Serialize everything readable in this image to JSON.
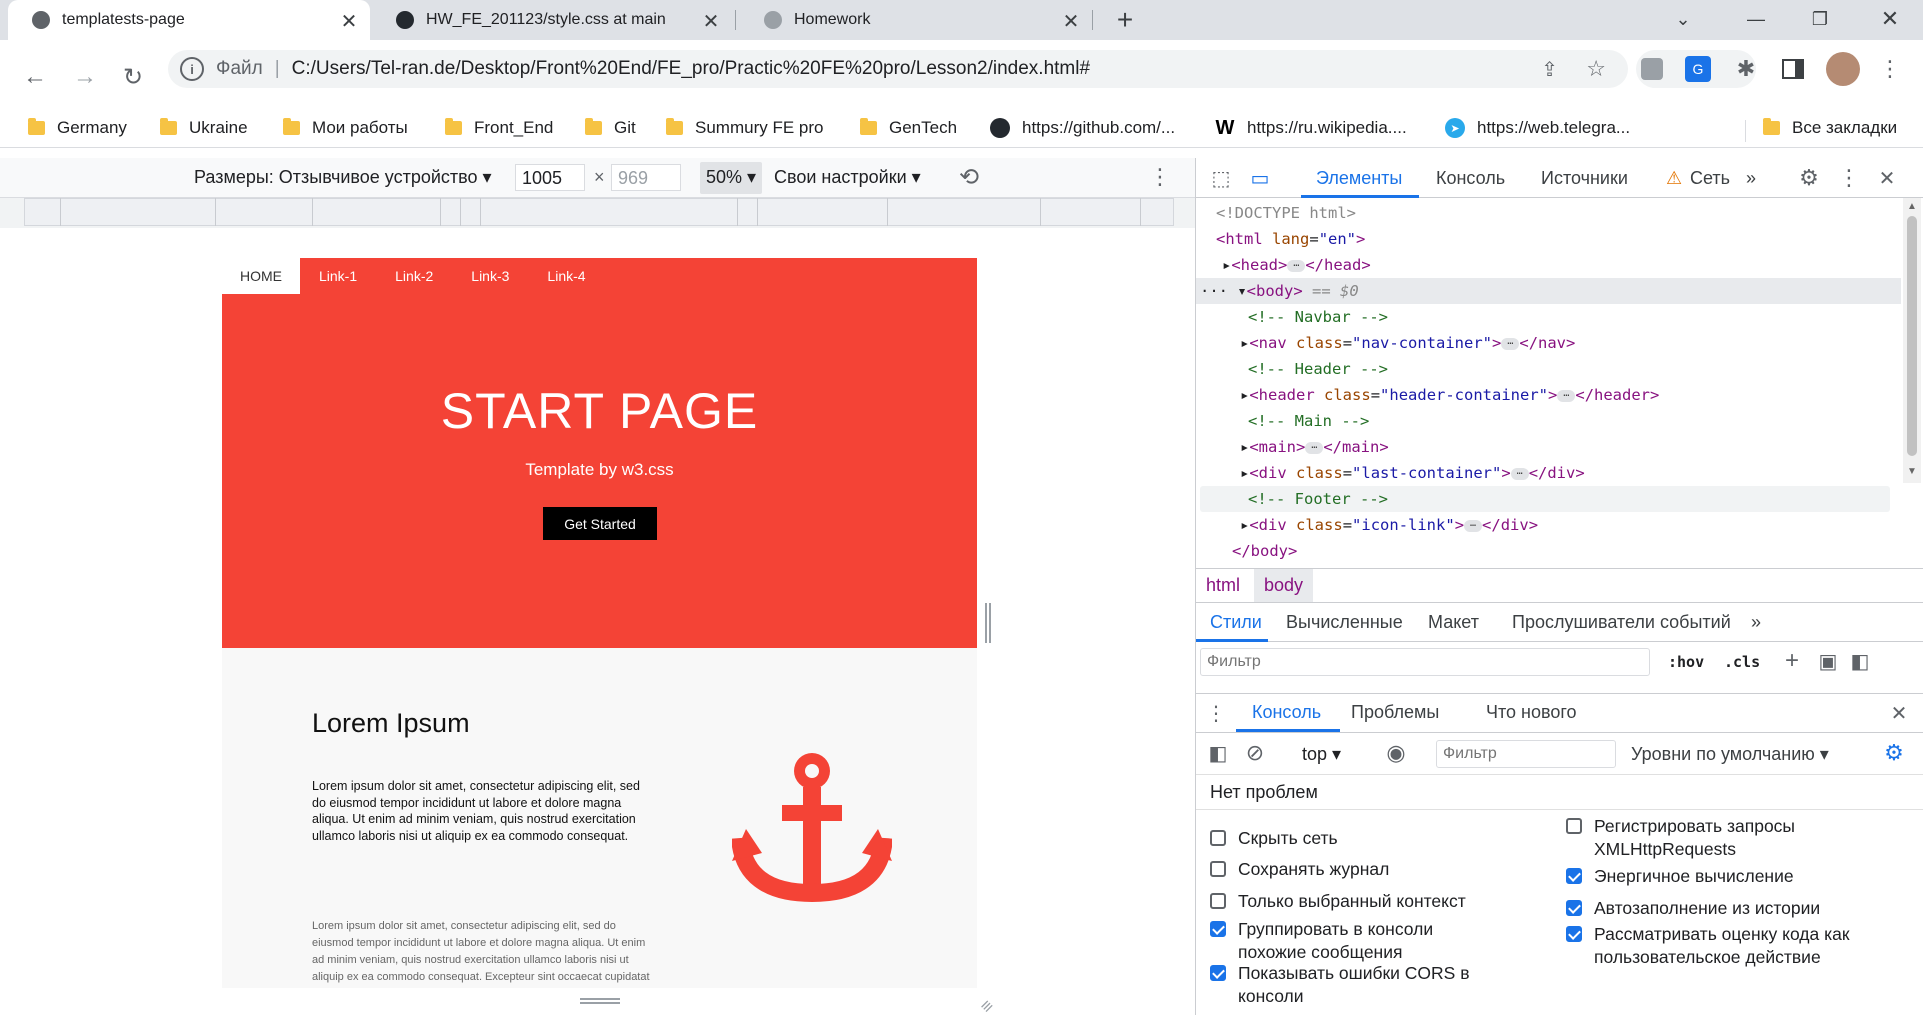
{
  "browser": {
    "tabs": [
      {
        "title": "templatests-page",
        "icon": "globe-icon"
      },
      {
        "title": "HW_FE_201123/style.css at main",
        "icon": "github-icon"
      },
      {
        "title": "Homework",
        "icon": "gear-favicon-icon"
      }
    ],
    "address": {
      "scheme_label": "Файл",
      "url": "C:/Users/Tel-ran.de/Desktop/Front%20End/FE_pro/Practic%20FE%20pro/Lesson2/index.html#"
    },
    "bookmarks": [
      {
        "label": "Germany",
        "icon": "folder-icon"
      },
      {
        "label": "Ukraine",
        "icon": "folder-icon"
      },
      {
        "label": "Мои работы",
        "icon": "folder-icon"
      },
      {
        "label": "Front_End",
        "icon": "folder-icon"
      },
      {
        "label": "Git",
        "icon": "folder-icon"
      },
      {
        "label": "Summury FE pro",
        "icon": "folder-icon"
      },
      {
        "label": "GenTech",
        "icon": "folder-icon"
      },
      {
        "label": "https://github.com/...",
        "icon": "github-icon"
      },
      {
        "label": "https://ru.wikipedia....",
        "icon": "wikipedia-icon"
      },
      {
        "label": "https://web.telegra...",
        "icon": "telegram-icon"
      },
      {
        "label": "Все закладки",
        "icon": "folder-icon"
      }
    ]
  },
  "emulation": {
    "dimensions_label": "Размеры: Отзывчивое устройство",
    "width": "1005",
    "height": "969",
    "zoom": "50%",
    "throttle": "Свои настройки"
  },
  "site": {
    "nav": [
      "HOME",
      "Link-1",
      "Link-2",
      "Link-3",
      "Link-4"
    ],
    "hero_title": "START PAGE",
    "hero_sub": "Template by w3.css",
    "hero_button": "Get Started",
    "section_title": "Lorem Ipsum",
    "para1": "Lorem ipsum dolor sit amet, consectetur adipiscing elit, sed do eiusmod tempor incididunt ut labore et dolore magna aliqua. Ut enim ad minim veniam, quis nostrud exercitation ullamco laboris nisi ut aliquip ex ea commodo consequat.",
    "para2": "Lorem ipsum dolor sit amet, consectetur adipiscing elit, sed do eiusmod tempor incididunt ut labore et dolore magna aliqua. Ut enim ad minim veniam, quis nostrud exercitation ullamco laboris nisi ut aliquip ex ea commodo consequat. Excepteur sint occaecat cupidatat",
    "accent": "#f44336"
  },
  "devtools": {
    "tabs": [
      "Элементы",
      "Консоль",
      "Источники",
      "Сеть"
    ],
    "dom": {
      "doctype": "<!DOCTYPE html>",
      "html_open": "<html",
      "lang_attr": "lang",
      "lang_val": "\"en\"",
      "head": "<head>",
      "head_close": "</head>",
      "body": "<body>",
      "body_marker": "== $0",
      "c_navbar": "<!-- Navbar -->",
      "nav_tag": "<nav",
      "nav_class": "\"nav-container\"",
      "nav_close": "</nav>",
      "c_header": "<!-- Header -->",
      "header_tag": "<header",
      "header_class": "\"header-container\"",
      "header_close": "</header>",
      "c_main": "<!-- Main -->",
      "main": "<main>",
      "main_close": "</main>",
      "div_tag": "<div",
      "last_class": "\"last-container\"",
      "div_close": "</div>",
      "c_footer": "<!-- Footer -->",
      "icon_class": "\"icon-link\"",
      "body_close": "</body>",
      "class_attr": "class"
    },
    "breadcrumbs": [
      "html",
      "body"
    ],
    "style_tabs": [
      "Стили",
      "Вычисленные",
      "Макет",
      "Прослушиватели событий"
    ],
    "filter_placeholder": "Фильтр",
    "hov": ":hov",
    "cls": ".cls",
    "drawer_tabs": [
      "Консоль",
      "Проблемы",
      "Что нового"
    ],
    "console": {
      "context": "top",
      "filter_placeholder": "Фильтр",
      "levels": "Уровни по умолчанию",
      "issues": "Нет проблем",
      "settings_left": [
        {
          "label": "Скрыть сеть",
          "checked": false
        },
        {
          "label": "Сохранять журнал",
          "checked": false
        },
        {
          "label": "Только выбранный контекст",
          "checked": false
        },
        {
          "label": "Группировать в консоли похожие сообщения",
          "checked": true
        },
        {
          "label": "Показывать ошибки CORS в консоли",
          "checked": true
        }
      ],
      "settings_right": [
        {
          "label": "Регистрировать запросы XMLHttpRequests",
          "checked": false
        },
        {
          "label": "Энергичное вычисление",
          "checked": true
        },
        {
          "label": "Автозаполнение из истории",
          "checked": true
        },
        {
          "label": "Рассматривать оценку кода как пользовательское действие",
          "checked": true
        }
      ]
    }
  }
}
